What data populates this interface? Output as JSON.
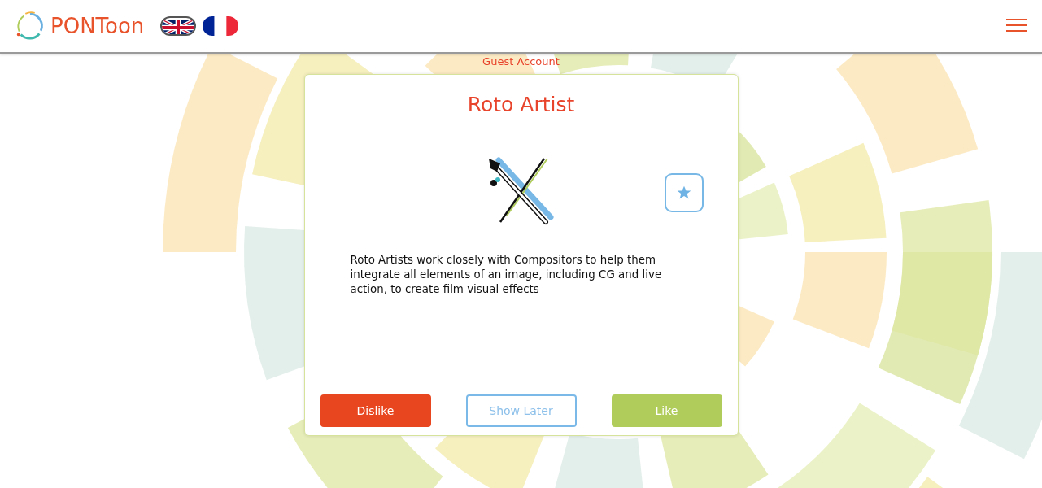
{
  "header": {
    "brand": "PONToon",
    "languages": [
      {
        "kind": "uk",
        "selected": true
      },
      {
        "kind": "france",
        "selected": false
      }
    ]
  },
  "account": "Guest Account",
  "card": {
    "title": "Roto Artist",
    "description": "Roto Artists work closely with Compositors to help them integrate all elements of an image, including CG and live action, to create film visual effects",
    "buttons": [
      {
        "kind": "dislike",
        "label": "Dislike"
      },
      {
        "kind": "later",
        "label": "Show Later"
      },
      {
        "kind": "like",
        "label": "Like"
      }
    ]
  }
}
